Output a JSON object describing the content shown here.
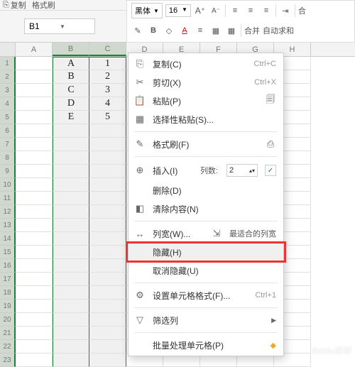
{
  "toolbar": {
    "copy": "复制",
    "format_painter": "格式刷",
    "merge": "合并",
    "autosum": "自动求和",
    "font_name": "黑体",
    "font_size": "16"
  },
  "name_box": {
    "value": "B1"
  },
  "columns": [
    "A",
    "B",
    "C",
    "D",
    "E",
    "F",
    "G",
    "H"
  ],
  "rows": [
    1,
    2,
    3,
    4,
    5,
    6,
    7,
    8,
    9,
    10,
    11,
    12,
    13,
    14,
    15,
    16,
    17,
    18,
    19,
    20,
    21,
    22,
    23
  ],
  "cells": {
    "B1": "A",
    "C1": "1",
    "B2": "B",
    "C2": "2",
    "B3": "C",
    "C3": "3",
    "B4": "D",
    "C4": "4",
    "B5": "E",
    "C5": "5"
  },
  "menu": {
    "copy": "复制(C)",
    "copy_sc": "Ctrl+C",
    "cut": "剪切(X)",
    "cut_sc": "Ctrl+X",
    "paste": "粘贴(P)",
    "paste_special": "选择性粘贴(S)...",
    "format_painter": "格式刷(F)",
    "insert": "插入(I)",
    "insert_cols_label": "列数:",
    "insert_cols_value": "2",
    "delete": "删除(D)",
    "clear": "清除内容(N)",
    "col_width": "列宽(W)...",
    "best_fit": "最适合的列宽",
    "hide": "隐藏(H)",
    "unhide": "取消隐藏(U)",
    "format_cells": "设置单元格格式(F)...",
    "format_cells_sc": "Ctrl+1",
    "filter": "筛选列",
    "batch": "批量处理单元格(P)"
  },
  "watermark": "Baidu经验"
}
